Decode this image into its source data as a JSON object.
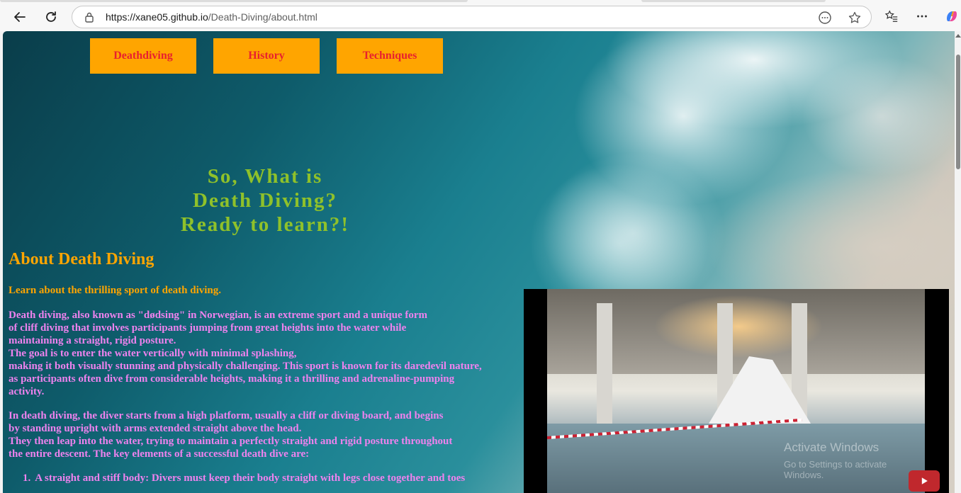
{
  "browser": {
    "url_host": "https://xane05.github.io",
    "url_path": "/Death-Diving/about.html"
  },
  "nav": {
    "items": [
      {
        "label": "Deathdiving"
      },
      {
        "label": "History"
      },
      {
        "label": "Techniques"
      }
    ]
  },
  "hero": {
    "line1": "So, What is",
    "line2": "Death Diving?",
    "line3": "Ready to learn?!"
  },
  "about": {
    "heading": "About Death Diving",
    "intro": "Learn about the thrilling sport of death diving.",
    "para1": [
      "Death diving, also known as \"dødsing\" in Norwegian, is an extreme sport and a unique form",
      "of cliff diving that involves participants jumping from great heights into the water while",
      "maintaining a straight, rigid posture.",
      "The goal is to enter the water vertically with minimal splashing,",
      "making it both visually stunning and physically challenging. This sport is known for its daredevil nature,",
      "as participants often dive from considerable heights, making it a thrilling and adrenaline-pumping",
      "activity."
    ],
    "para2": [
      "In death diving, the diver starts from a high platform, usually a cliff or diving board, and begins",
      "by standing upright with arms extended straight above the head.",
      "They then leap into the water, trying to maintain a perfectly straight and rigid posture throughout",
      "the entire descent. The key elements of a successful death dive are:"
    ],
    "list": [
      {
        "num": "1.",
        "text": "A straight and stiff body: Divers must keep their body straight with legs close together and toes"
      }
    ]
  },
  "video": {
    "watermark_title": "Activate Windows",
    "watermark_sub": "Go to Settings to activate Windows."
  }
}
